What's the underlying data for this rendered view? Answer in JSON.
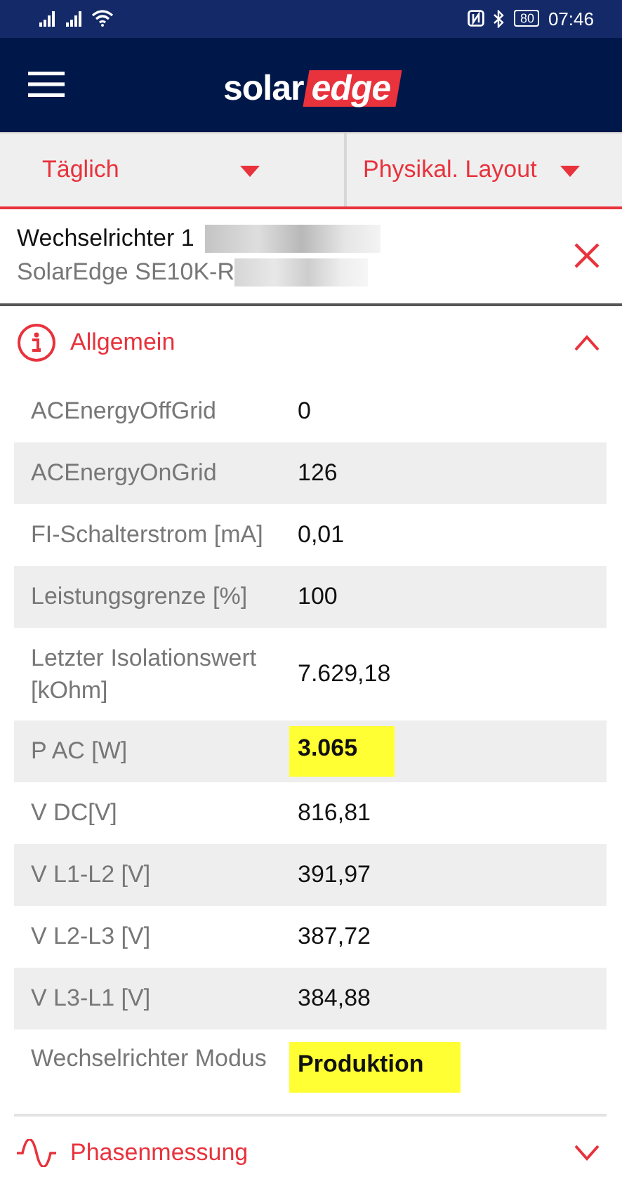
{
  "status_bar": {
    "battery": "80",
    "time": "07:46"
  },
  "app_bar": {
    "logo_left": "solar",
    "logo_right": "edge"
  },
  "filters": [
    {
      "label": "Täglich"
    },
    {
      "label": "Physikal. Layout"
    }
  ],
  "device": {
    "name": "Wechselrichter 1",
    "model": "SolarEdge SE10K-R",
    "redacted": true
  },
  "sections": [
    {
      "title": "Allgemein",
      "kind": "info",
      "expanded": true,
      "rows": [
        {
          "label": "ACEnergyOffGrid",
          "value": "0",
          "highlighted": false
        },
        {
          "label": "ACEnergyOnGrid",
          "value": "126",
          "highlighted": false
        },
        {
          "label": "FI-Schalterstrom [mA]",
          "value": "0,01",
          "highlighted": false
        },
        {
          "label": "Leistungsgrenze [%]",
          "value": "100",
          "highlighted": false
        },
        {
          "label": "Letzter Isolationswert [kOhm]",
          "value": "7.629,18",
          "highlighted": false
        },
        {
          "label": "P AC [W]",
          "value": "3.065",
          "highlighted": true
        },
        {
          "label": "V DC[V]",
          "value": "816,81",
          "highlighted": false
        },
        {
          "label": "V L1-L2 [V]",
          "value": "391,97",
          "highlighted": false
        },
        {
          "label": "V L2-L3 [V]",
          "value": "387,72",
          "highlighted": false
        },
        {
          "label": "V L3-L1 [V]",
          "value": "384,88",
          "highlighted": false
        },
        {
          "label": "Wechselrichter Modus",
          "value": "Produktion",
          "highlighted": true
        }
      ]
    },
    {
      "title": "Phasenmessung",
      "kind": "wave",
      "expanded": false
    }
  ]
}
